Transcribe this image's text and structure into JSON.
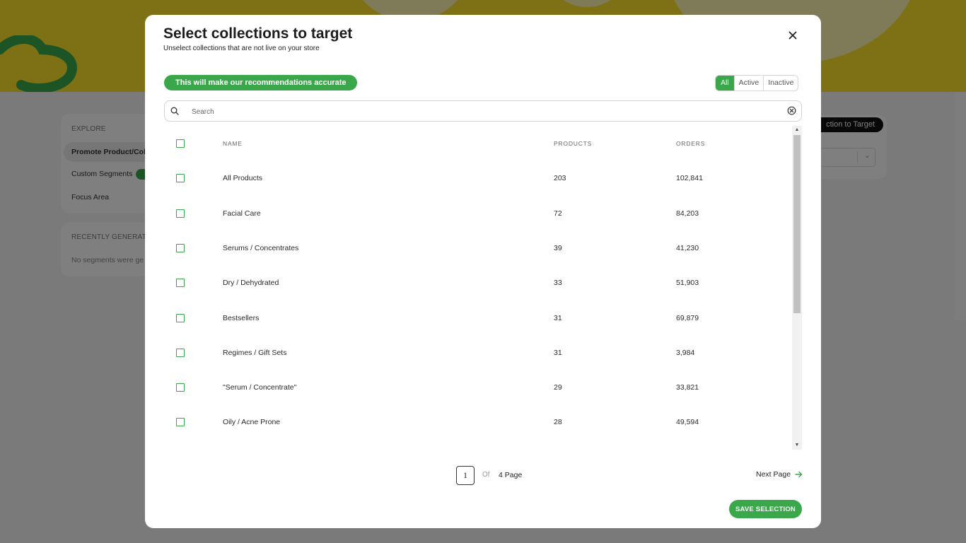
{
  "background": {
    "sidebar": {
      "section_label": "EXPLORE",
      "items": [
        {
          "label": "Promote Product/Coll"
        },
        {
          "label": "Custom Segments"
        },
        {
          "label": "Focus Area"
        }
      ],
      "recent_label": "RECENTLY GENERATED",
      "recent_empty": "No segments were ge"
    },
    "top_button": "ction to Target"
  },
  "modal": {
    "title": "Select collections to target",
    "subtitle": "Unselect collections that are not live on your store",
    "info_pill": "This will make our recommendations accurate",
    "filters": [
      {
        "label": "All",
        "active": true
      },
      {
        "label": "Active",
        "active": false
      },
      {
        "label": "Inactive",
        "active": false
      }
    ],
    "search": {
      "placeholder": "Search",
      "value": ""
    },
    "table": {
      "headers": {
        "name": "NAME",
        "products": "PRODUCTS",
        "orders": "ORDERS"
      },
      "rows": [
        {
          "name": "All Products",
          "products": "203",
          "orders": "102,841"
        },
        {
          "name": "Facial Care",
          "products": "72",
          "orders": "84,203"
        },
        {
          "name": "Serums / Concentrates",
          "products": "39",
          "orders": "41,230"
        },
        {
          "name": "Dry / Dehydrated",
          "products": "33",
          "orders": "51,903"
        },
        {
          "name": "Bestsellers",
          "products": "31",
          "orders": "69,879"
        },
        {
          "name": "Regimes / Gift Sets",
          "products": "31",
          "orders": "3,984"
        },
        {
          "name": "\"Serum / Concentrate\"",
          "products": "29",
          "orders": "33,821"
        },
        {
          "name": "Oily / Acne Prone",
          "products": "28",
          "orders": "49,594"
        }
      ]
    },
    "pagination": {
      "current": "1",
      "of": "Of",
      "total": "4 Page",
      "next": "Next Page"
    },
    "save_button": "SAVE SELECTION"
  },
  "colors": {
    "accent": "#3aa84a",
    "banner": "#fde32a"
  },
  "icons": {
    "close": "close-icon",
    "search": "search-icon",
    "clear": "clear-circle-icon",
    "next": "arrow-right-icon"
  }
}
